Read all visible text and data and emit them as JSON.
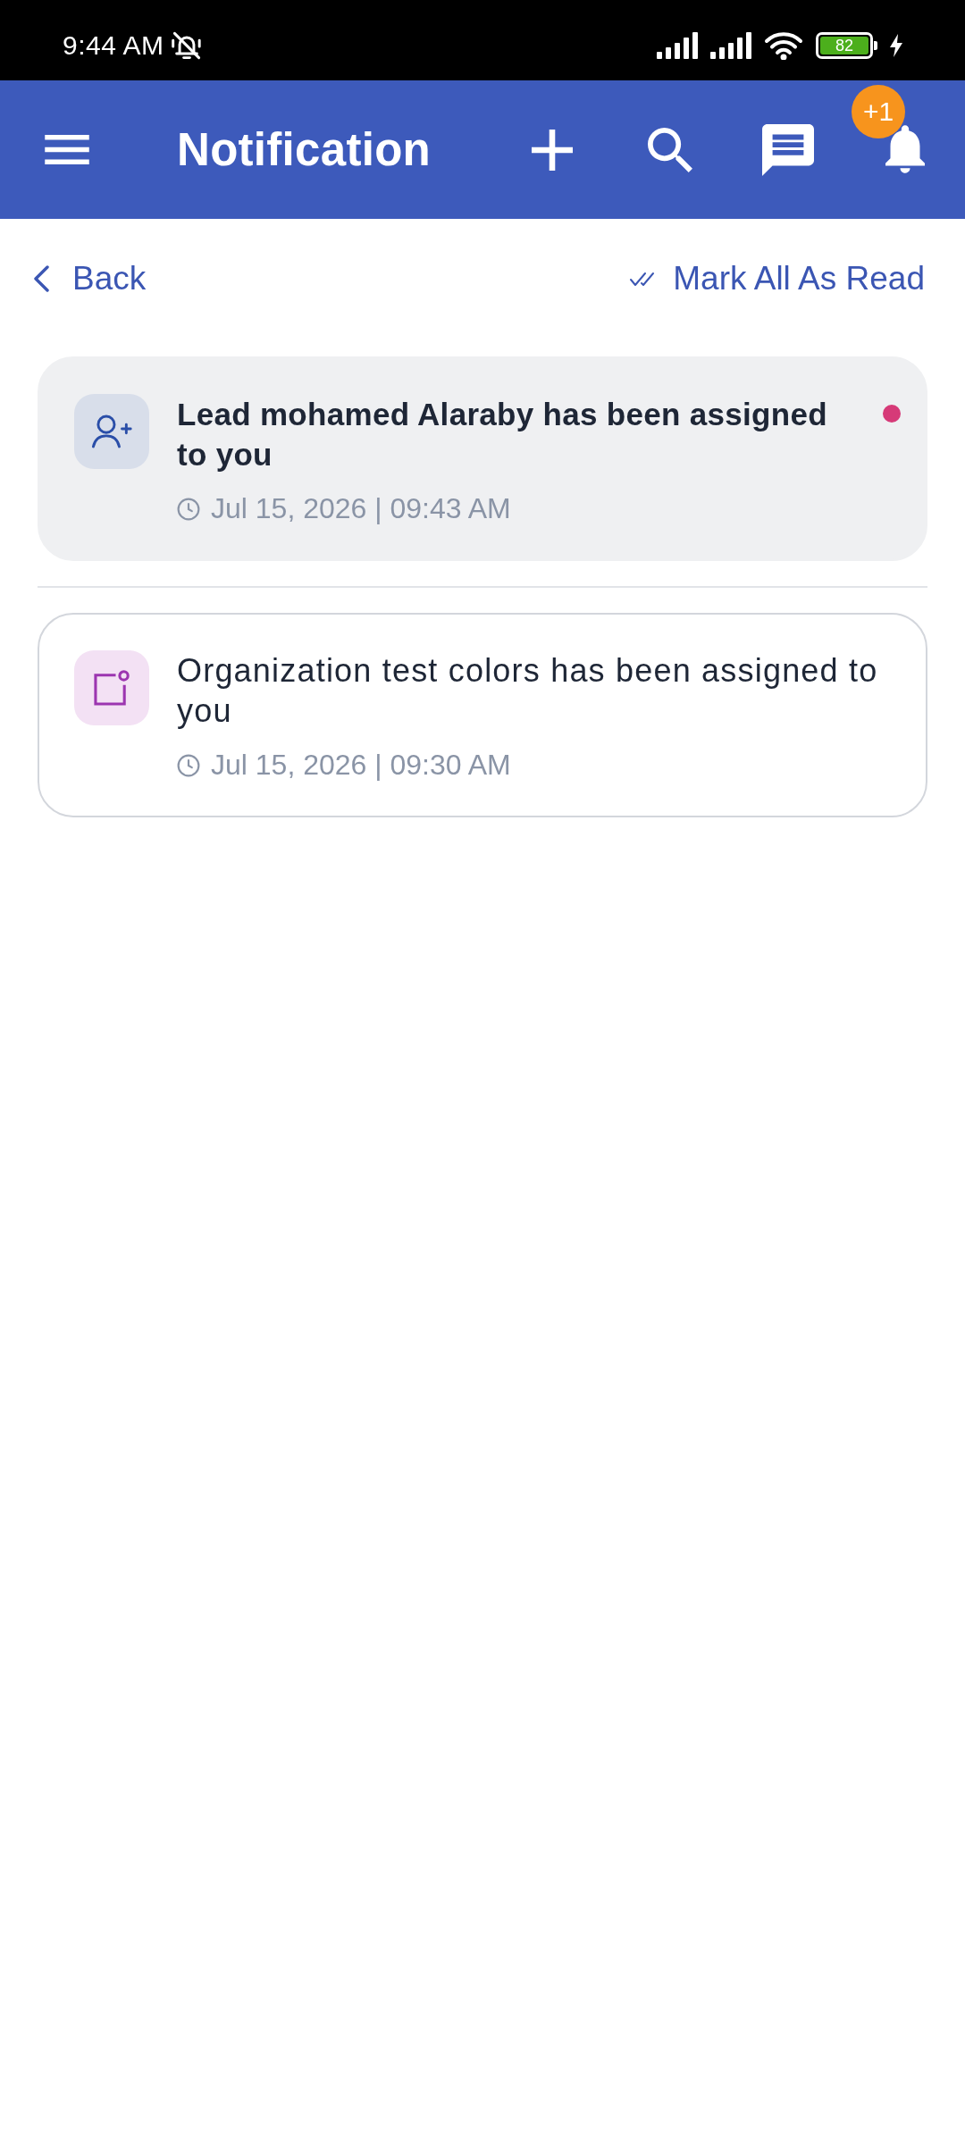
{
  "status_bar": {
    "time": "9:44 AM",
    "battery": "82"
  },
  "app_bar": {
    "title": "Notification",
    "badge": "+1"
  },
  "actions": {
    "back": "Back",
    "mark_all": "Mark All As Read"
  },
  "notifications": [
    {
      "kind": "lead",
      "title": "Lead mohamed Alaraby has been assigned to you",
      "time": "Jul 15, 2026 | 09:43 AM",
      "unread": true
    },
    {
      "kind": "organization",
      "title": "Organization test colors has been assigned to you",
      "time": "Jul 15, 2026 | 09:30 AM",
      "unread": false
    }
  ]
}
